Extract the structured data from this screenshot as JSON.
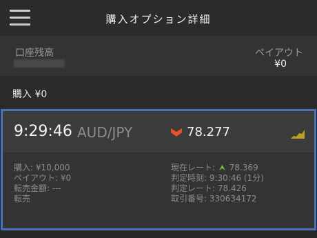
{
  "header": {
    "title": "購入オプション詳細",
    "menu_icon": "hamburger-menu-icon"
  },
  "account": {
    "label": "口座残高",
    "payout_label": "ペイアウト",
    "payout_value": "¥0"
  },
  "purchase": {
    "text": "購入 ¥0"
  },
  "option": {
    "time": "9:29:46",
    "pair": "AUD/JPY",
    "direction_icon": "down-arrow-icon",
    "rate": "78.277",
    "chart_icon": "mini-chart-icon",
    "direction_color": "#e8522a",
    "up_color": "#6cc24a",
    "chart_color": "#b8a020",
    "accent": "#4a72b8"
  },
  "details": {
    "left": [
      "購入: ¥10,000",
      "ペイアウト: ¥0",
      "転売金額: ---",
      "転売"
    ],
    "current_rate_label": "現在レート:",
    "current_rate_value": "78.369",
    "decision_time": "判定時刻: 9:30:46 (1分)",
    "decision_rate": "判定レート: 78.426",
    "trade_number": "取引番号: 330634172"
  }
}
